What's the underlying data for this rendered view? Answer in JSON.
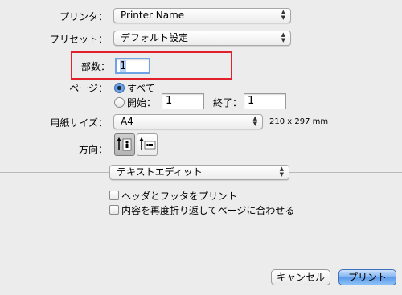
{
  "printer": {
    "label": "プリンタ：",
    "value": "Printer Name"
  },
  "preset": {
    "label": "プリセット：",
    "value": "デフォルト設定"
  },
  "copies": {
    "label": "部数：",
    "value": "1"
  },
  "pages": {
    "label": "ページ：",
    "all_label": "すべて",
    "from_label": "開始：",
    "from_value": "1",
    "to_label": "終了：",
    "to_value": "1"
  },
  "paper": {
    "label": "用紙サイズ：",
    "value": "A4",
    "dimensions": "210 x 297 mm"
  },
  "orientation": {
    "label": "方向："
  },
  "app_menu": {
    "value": "テキストエディット"
  },
  "options": {
    "header_footer": "ヘッダとフッタをプリント",
    "rewrap": "内容を再度折り返してページに合わせる"
  },
  "buttons": {
    "cancel": "キャンセル",
    "print": "プリント"
  },
  "highlight_color": "#e0202a"
}
